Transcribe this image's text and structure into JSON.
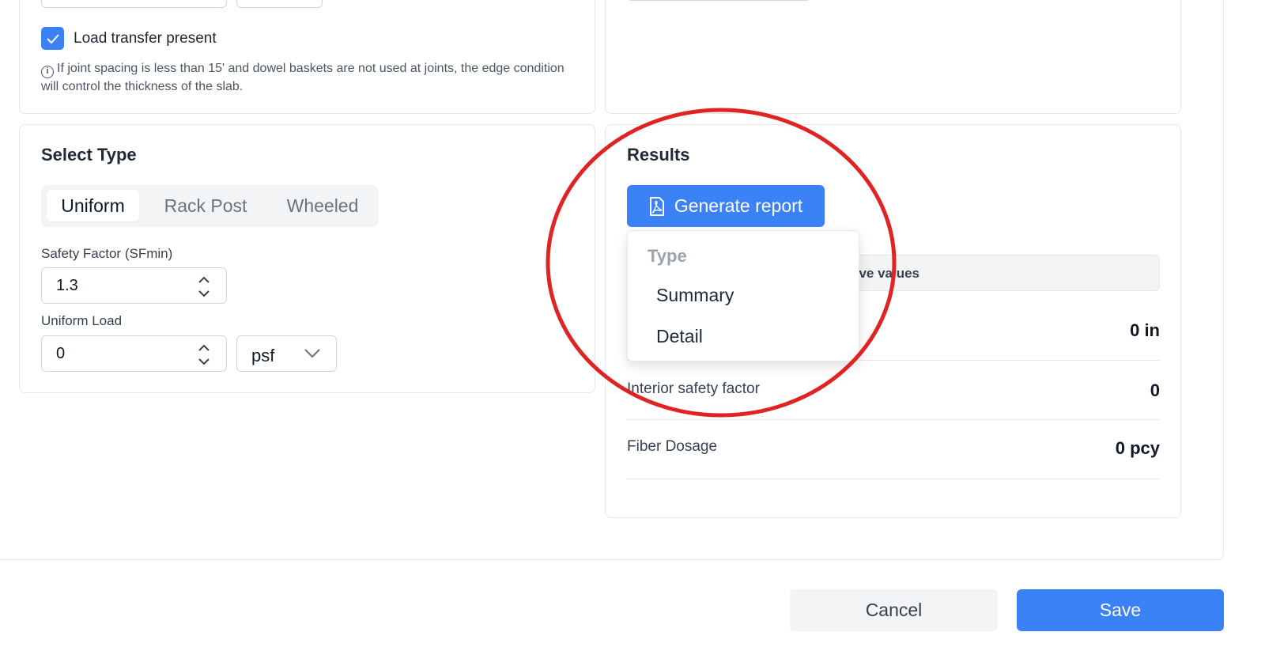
{
  "load_transfer": {
    "checked": true,
    "label": "Load transfer present",
    "note": "If joint spacing is less than 15' and dowel baskets are not used at joints, the edge condition will control the thickness of the slab."
  },
  "select_type": {
    "title": "Select Type",
    "tabs": [
      "Uniform",
      "Rack Post",
      "Wheeled"
    ],
    "active_tab": "Uniform",
    "safety_factor": {
      "label": "Safety Factor (SFmin)",
      "value": "1.3"
    },
    "uniform_load": {
      "label": "Uniform Load",
      "value": "0",
      "unit": "psf"
    }
  },
  "results": {
    "title": "Results",
    "generate_report_label": "Generate report",
    "partial_bar_text": "ave values",
    "rows": [
      {
        "label": "",
        "value": "0 in"
      },
      {
        "label": "Interior safety factor",
        "value": "0"
      },
      {
        "label": "Fiber Dosage",
        "value": "0 pcy"
      }
    ]
  },
  "report_dropdown": {
    "header": "Type",
    "options": [
      "Summary",
      "Detail"
    ]
  },
  "footer": {
    "cancel_label": "Cancel",
    "save_label": "Save"
  },
  "colors": {
    "accent": "#3b82f6",
    "annotation": "#e02424"
  }
}
